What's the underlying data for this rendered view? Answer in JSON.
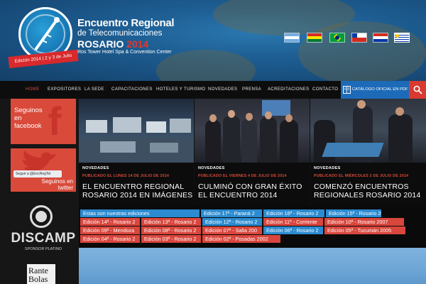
{
  "header": {
    "logo_line1": "Encuentro Regional",
    "logo_line2": "de Telecomunicaciones",
    "logo_city": "ROSARIO",
    "logo_year": "2014",
    "logo_venue": "Ros Tower Hotel Spa & Convention Center",
    "edition_tag": "Edición 2014  |  2 y 3 de Julio",
    "flags": [
      "argentina-flag",
      "bolivia-flag",
      "brazil-flag",
      "chile-flag",
      "paraguay-flag",
      "uruguay-flag"
    ]
  },
  "nav": {
    "items": [
      "HOME",
      "EXPOSITORES",
      "LA SEDE",
      "CAPACITACIONES",
      "HOTELES Y TURISMO",
      "NOVEDADES",
      "PRENSA",
      "ACREDITACIONES",
      "CONTACTO"
    ],
    "active": "HOME",
    "catalog_label": "CATÁLOGO OFICIAL EN PDF",
    "search_icon": "search-icon"
  },
  "sidebar": {
    "facebook_text": "Seguinos en facebook",
    "twitter_follow": "Seguir a @EncRegTel",
    "twitter_text": "Seguinos en twitter",
    "sponsor_name": "DISCAMP",
    "sponsor_label": "SPONSOR PLATINO",
    "sponsor2_text": "Rante Bolas"
  },
  "news": [
    {
      "category": "NOVEDADES",
      "date": "PUBLICADO EL LUNES 14 DE JULIO DE 2014",
      "title": "EL ENCUENTRO REGIONAL ROSARIO 2014 EN IMÁGENES"
    },
    {
      "category": "NOVEDADES",
      "date": "PUBLICADO EL VIERNES 4 DE JULIO DE 2014",
      "title": "CULMINÓ CON GRAN ÉXITO EL ENCUENTRO 2014"
    },
    {
      "category": "NOVEDADES",
      "date": "PUBLICADO EL MIÉRCOLES 2 DE JULIO DE 2014",
      "title": "COMENZÓ ENCUENTROS REGIONALES ROSARIO 2014"
    }
  ],
  "editions": {
    "intro": "Estas son nuestras ediciones",
    "row1": [
      "Edición 17ª - Paraná 2",
      "Edición 16ª - Rosario 2",
      "Edición 15ª - Rosario 2011"
    ],
    "row2": [
      "Edición 14ª - Rosario 2",
      "Edición 13ª - Rosario 2",
      "Edición 12ª - Rosario 2",
      "Edición 11ª - Corriente",
      "Edición 10ª - Rosario 2007"
    ],
    "row3": [
      "Edición 09ª - Mendoza",
      "Edición 08ª - Rosario 2",
      "Edición 07ª - Salta 200",
      "Edición 06ª - Rosario 2",
      "Edición 05ª - Tucumán 2005"
    ],
    "row4": [
      "Edición 04ª - Rosario 2",
      "Edición 03ª - Rosario 2",
      "Edición 02ª - Posadas 2002"
    ]
  }
}
